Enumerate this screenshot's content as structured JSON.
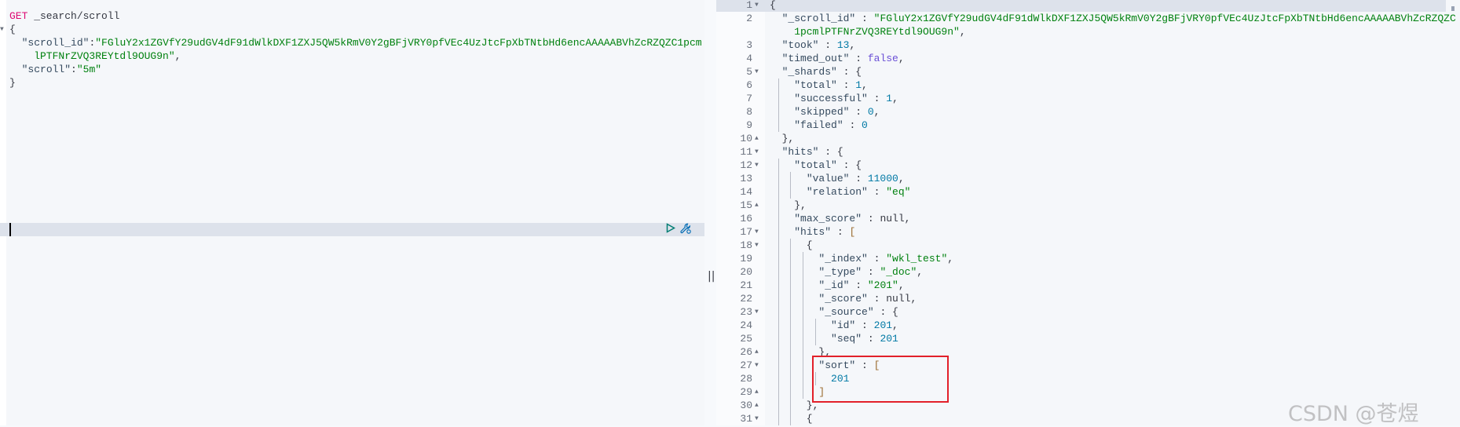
{
  "request": {
    "method": "GET",
    "path": " _search/scroll",
    "lines": [
      [
        [
          "p",
          "{"
        ]
      ],
      [
        [
          "p",
          "  "
        ],
        [
          "k",
          "\"scroll_id\""
        ],
        [
          "p",
          ":"
        ],
        [
          "s",
          "\"FGluY2x1ZGVfY29udGV4dF91dWlkDXF1ZXJ5QW5kRmV0Y2gBFjVRY0pfVEc4UzJtcFpXbTNtbHd6encAAAAABVhZcRZQZC1pcm"
        ]
      ],
      [
        [
          "s",
          "    lPTFNrZVQ3REYtdl9OUG9n\""
        ],
        [
          "p",
          ","
        ]
      ],
      [
        [
          "p",
          "  "
        ],
        [
          "k",
          "\"scroll\""
        ],
        [
          "p",
          ":"
        ],
        [
          "s",
          "\"5m\""
        ]
      ],
      [
        [
          "p",
          "}"
        ]
      ]
    ],
    "actions": {
      "run_icon": "play-icon",
      "settings_icon": "wrench-icon"
    }
  },
  "response": {
    "lines": [
      {
        "n": "1",
        "fold": "down",
        "t": [
          [
            "p",
            "{"
          ]
        ]
      },
      {
        "n": "2",
        "fold": "",
        "t": [
          [
            "p",
            "  "
          ],
          [
            "k",
            "\"_scroll_id\""
          ],
          [
            "p",
            " : "
          ],
          [
            "s",
            "\"FGluY2x1ZGVfY29udGV4dF91dWlkDXF1ZXJ5QW5kRmV0Y2gBFjVRY0pfVEc4UzJtcFpXbTNtbHd6encAAAAABVhZcRZQZC"
          ]
        ]
      },
      {
        "n": "",
        "fold": "",
        "t": [
          [
            "s",
            "    1pcmlPTFNrZVQ3REYtdl9OUG9n\""
          ],
          [
            "p",
            ","
          ]
        ]
      },
      {
        "n": "3",
        "fold": "",
        "t": [
          [
            "p",
            "  "
          ],
          [
            "k",
            "\"took\""
          ],
          [
            "p",
            " : "
          ],
          [
            "n",
            "13"
          ],
          [
            "p",
            ","
          ]
        ]
      },
      {
        "n": "4",
        "fold": "",
        "t": [
          [
            "p",
            "  "
          ],
          [
            "k",
            "\"timed_out\""
          ],
          [
            "p",
            " : "
          ],
          [
            "b",
            "false"
          ],
          [
            "p",
            ","
          ]
        ]
      },
      {
        "n": "5",
        "fold": "down",
        "t": [
          [
            "p",
            "  "
          ],
          [
            "k",
            "\"_shards\""
          ],
          [
            "p",
            " : {"
          ]
        ]
      },
      {
        "n": "6",
        "fold": "",
        "t": [
          [
            "p",
            "    "
          ],
          [
            "k",
            "\"total\""
          ],
          [
            "p",
            " : "
          ],
          [
            "n",
            "1"
          ],
          [
            "p",
            ","
          ]
        ]
      },
      {
        "n": "7",
        "fold": "",
        "t": [
          [
            "p",
            "    "
          ],
          [
            "k",
            "\"successful\""
          ],
          [
            "p",
            " : "
          ],
          [
            "n",
            "1"
          ],
          [
            "p",
            ","
          ]
        ]
      },
      {
        "n": "8",
        "fold": "",
        "t": [
          [
            "p",
            "    "
          ],
          [
            "k",
            "\"skipped\""
          ],
          [
            "p",
            " : "
          ],
          [
            "n",
            "0"
          ],
          [
            "p",
            ","
          ]
        ]
      },
      {
        "n": "9",
        "fold": "",
        "t": [
          [
            "p",
            "    "
          ],
          [
            "k",
            "\"failed\""
          ],
          [
            "p",
            " : "
          ],
          [
            "n",
            "0"
          ]
        ]
      },
      {
        "n": "10",
        "fold": "up",
        "t": [
          [
            "p",
            "  },"
          ]
        ]
      },
      {
        "n": "11",
        "fold": "down",
        "t": [
          [
            "p",
            "  "
          ],
          [
            "k",
            "\"hits\""
          ],
          [
            "p",
            " : {"
          ]
        ]
      },
      {
        "n": "12",
        "fold": "down",
        "t": [
          [
            "p",
            "    "
          ],
          [
            "k",
            "\"total\""
          ],
          [
            "p",
            " : {"
          ]
        ]
      },
      {
        "n": "13",
        "fold": "",
        "t": [
          [
            "p",
            "      "
          ],
          [
            "k",
            "\"value\""
          ],
          [
            "p",
            " : "
          ],
          [
            "n",
            "11000"
          ],
          [
            "p",
            ","
          ]
        ]
      },
      {
        "n": "14",
        "fold": "",
        "t": [
          [
            "p",
            "      "
          ],
          [
            "k",
            "\"relation\""
          ],
          [
            "p",
            " : "
          ],
          [
            "s",
            "\"eq\""
          ]
        ]
      },
      {
        "n": "15",
        "fold": "up",
        "t": [
          [
            "p",
            "    },"
          ]
        ]
      },
      {
        "n": "16",
        "fold": "",
        "t": [
          [
            "p",
            "    "
          ],
          [
            "k",
            "\"max_score\""
          ],
          [
            "p",
            " : "
          ],
          [
            "l",
            "null"
          ],
          [
            "p",
            ","
          ]
        ]
      },
      {
        "n": "17",
        "fold": "down",
        "t": [
          [
            "p",
            "    "
          ],
          [
            "k",
            "\"hits\""
          ],
          [
            "p",
            " : "
          ],
          [
            "br",
            "["
          ]
        ]
      },
      {
        "n": "18",
        "fold": "down",
        "t": [
          [
            "p",
            "      {"
          ]
        ]
      },
      {
        "n": "19",
        "fold": "",
        "t": [
          [
            "p",
            "        "
          ],
          [
            "k",
            "\"_index\""
          ],
          [
            "p",
            " : "
          ],
          [
            "s",
            "\"wkl_test\""
          ],
          [
            "p",
            ","
          ]
        ]
      },
      {
        "n": "20",
        "fold": "",
        "t": [
          [
            "p",
            "        "
          ],
          [
            "k",
            "\"_type\""
          ],
          [
            "p",
            " : "
          ],
          [
            "s",
            "\"_doc\""
          ],
          [
            "p",
            ","
          ]
        ]
      },
      {
        "n": "21",
        "fold": "",
        "t": [
          [
            "p",
            "        "
          ],
          [
            "k",
            "\"_id\""
          ],
          [
            "p",
            " : "
          ],
          [
            "s",
            "\"201\""
          ],
          [
            "p",
            ","
          ]
        ]
      },
      {
        "n": "22",
        "fold": "",
        "t": [
          [
            "p",
            "        "
          ],
          [
            "k",
            "\"_score\""
          ],
          [
            "p",
            " : "
          ],
          [
            "l",
            "null"
          ],
          [
            "p",
            ","
          ]
        ]
      },
      {
        "n": "23",
        "fold": "down",
        "t": [
          [
            "p",
            "        "
          ],
          [
            "k",
            "\"_source\""
          ],
          [
            "p",
            " : {"
          ]
        ]
      },
      {
        "n": "24",
        "fold": "",
        "t": [
          [
            "p",
            "          "
          ],
          [
            "k",
            "\"id\""
          ],
          [
            "p",
            " : "
          ],
          [
            "n",
            "201"
          ],
          [
            "p",
            ","
          ]
        ]
      },
      {
        "n": "25",
        "fold": "",
        "t": [
          [
            "p",
            "          "
          ],
          [
            "k",
            "\"seq\""
          ],
          [
            "p",
            " : "
          ],
          [
            "n",
            "201"
          ]
        ]
      },
      {
        "n": "26",
        "fold": "up",
        "t": [
          [
            "p",
            "        },"
          ]
        ]
      },
      {
        "n": "27",
        "fold": "down",
        "t": [
          [
            "p",
            "        "
          ],
          [
            "k",
            "\"sort\""
          ],
          [
            "p",
            " : "
          ],
          [
            "br",
            "["
          ]
        ]
      },
      {
        "n": "28",
        "fold": "",
        "t": [
          [
            "p",
            "          "
          ],
          [
            "n",
            "201"
          ]
        ]
      },
      {
        "n": "29",
        "fold": "up",
        "t": [
          [
            "p",
            "        "
          ],
          [
            "br",
            "]"
          ]
        ]
      },
      {
        "n": "30",
        "fold": "up",
        "t": [
          [
            "p",
            "      },"
          ]
        ]
      },
      {
        "n": "31",
        "fold": "down",
        "t": [
          [
            "p",
            "      {"
          ]
        ]
      }
    ]
  },
  "divider_icon": "||",
  "watermark": "CSDN @苍煜",
  "colors": {
    "highlight_box": "#e2202a",
    "string": "#00810f",
    "number": "#0079a5",
    "method": "#dd0a73"
  }
}
